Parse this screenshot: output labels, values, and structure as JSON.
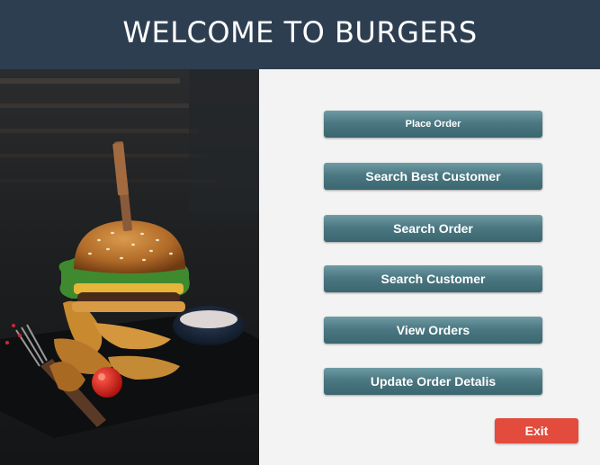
{
  "header": {
    "title": "WELCOME TO BURGERS"
  },
  "menu": {
    "place_order": "Place Order",
    "search_best_customer": "Search Best Customer",
    "search_order": "Search Order",
    "search_customer": "Search Customer",
    "view_orders": "View Orders",
    "update_order_details": "Update Order Detalis",
    "exit": "Exit"
  },
  "colors": {
    "header_bg": "#2e3e51",
    "button_teal": "#4b7882",
    "exit_red": "#e34b3c",
    "panel_bg": "#f3f3f3"
  }
}
